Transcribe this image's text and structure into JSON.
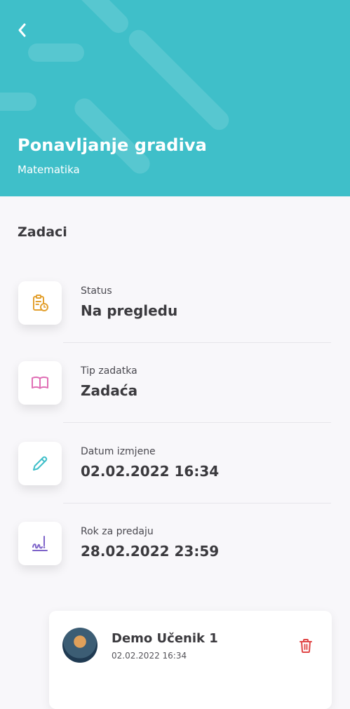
{
  "header": {
    "title": "Ponavljanje gradiva",
    "subtitle": "Matematika",
    "background_color": "#3fbfc9",
    "back_icon": "chevron-left-icon"
  },
  "section": {
    "title": "Zadaci"
  },
  "info_rows": [
    {
      "icon": "clipboard-clock-icon",
      "icon_color": "#e3a02f",
      "label": "Status",
      "value": "Na pregledu"
    },
    {
      "icon": "book-open-icon",
      "icon_color": "#e06fb5",
      "label": "Tip zadatka",
      "value": "Zadaća"
    },
    {
      "icon": "pencil-icon",
      "icon_color": "#3fbfc9",
      "label": "Datum izmjene",
      "value": "02.02.2022 16:34"
    },
    {
      "icon": "signature-icon",
      "icon_color": "#7d63c9",
      "label": "Rok za predaju",
      "value": "28.02.2022 23:59"
    }
  ],
  "submission": {
    "student_name": "Demo Učenik 1",
    "date": "02.02.2022 16:34",
    "delete_icon": "trash-icon",
    "delete_color": "#e04646"
  }
}
